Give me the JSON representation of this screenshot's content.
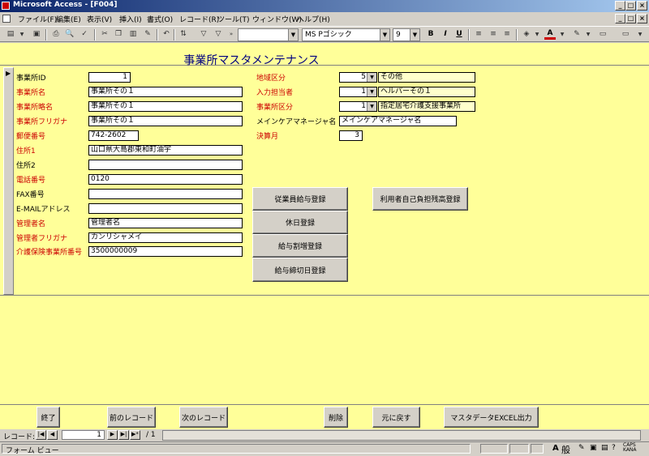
{
  "window": {
    "title": "Microsoft Access - [F004]"
  },
  "menu": [
    "ファイル(F)",
    "編集(E)",
    "表示(V)",
    "挿入(I)",
    "書式(O)",
    "レコード(R)",
    "ツール(T)",
    "ウィンドウ(W)",
    "ヘルプ(H)"
  ],
  "toolbar": {
    "font_name": "MS Pゴシック",
    "font_size": "9",
    "bold": "B",
    "italic": "I",
    "underline": "U"
  },
  "form": {
    "title": "事業所マスタメンテナンス",
    "left_fields": [
      {
        "label": "事業所ID",
        "value": "1",
        "color": "#000000",
        "align": "right"
      },
      {
        "label": "事業所名",
        "value": "事業所その１",
        "color": "#cc0000",
        "align": "left"
      },
      {
        "label": "事業所略名",
        "value": "事業所その１",
        "color": "#cc0000",
        "align": "left"
      },
      {
        "label": "事業所フリガナ",
        "value": "事業所その１",
        "color": "#cc0000",
        "align": "left"
      },
      {
        "label": "郵便番号",
        "value": "742-2602",
        "color": "#cc0000",
        "align": "left"
      },
      {
        "label": "住所1",
        "value": "山口県大島郡東和町油宇",
        "color": "#cc0000",
        "align": "left"
      },
      {
        "label": "住所2",
        "value": "",
        "color": "#000000",
        "align": "left"
      },
      {
        "label": "電話番号",
        "value": "0120",
        "color": "#cc0000",
        "align": "left"
      },
      {
        "label": "FAX番号",
        "value": "",
        "color": "#000000",
        "align": "left"
      },
      {
        "label": "E-MAILアドレス",
        "value": "",
        "color": "#000000",
        "align": "left"
      },
      {
        "label": "管理者名",
        "value": "管理者名",
        "color": "#cc0000",
        "align": "left"
      },
      {
        "label": "管理者フリガナ",
        "value": "カンリシャメイ",
        "color": "#cc0000",
        "align": "left"
      },
      {
        "label": "介護保険事業所番号",
        "value": "3500000009",
        "color": "#cc0000",
        "align": "left"
      }
    ],
    "right_fields": {
      "area": {
        "label": "地域区分",
        "code": "5",
        "text": "その他"
      },
      "entry": {
        "label": "入力担当者",
        "code": "1",
        "text": "ヘルパーその１"
      },
      "category": {
        "label": "事業所区分",
        "code": "1",
        "text": "指定居宅介護支援事業所"
      },
      "care_manager": {
        "label": "メインケアマネージャ名",
        "value": "メインケアマネージャ名"
      },
      "fiscal_month": {
        "label": "決算月",
        "value": "3"
      }
    },
    "buttons": {
      "staff_salary": "従業員給与登録",
      "holiday": "休日登録",
      "salary_split": "給与割増登録",
      "salary_cutoff": "給与締切日登録",
      "user_burden": "利用者自己負担残高登録"
    }
  },
  "footer_buttons": [
    "終了",
    "前のレコード",
    "次のレコード",
    "削除",
    "元に戻す",
    "マスタデータEXCEL出力"
  ],
  "nav": {
    "label": "レコード:",
    "current": "1",
    "total": "/ 1"
  },
  "status": {
    "text": "フォーム ビュー",
    "ime": "般",
    "caps": "CAPS",
    "kana": "KANA"
  }
}
